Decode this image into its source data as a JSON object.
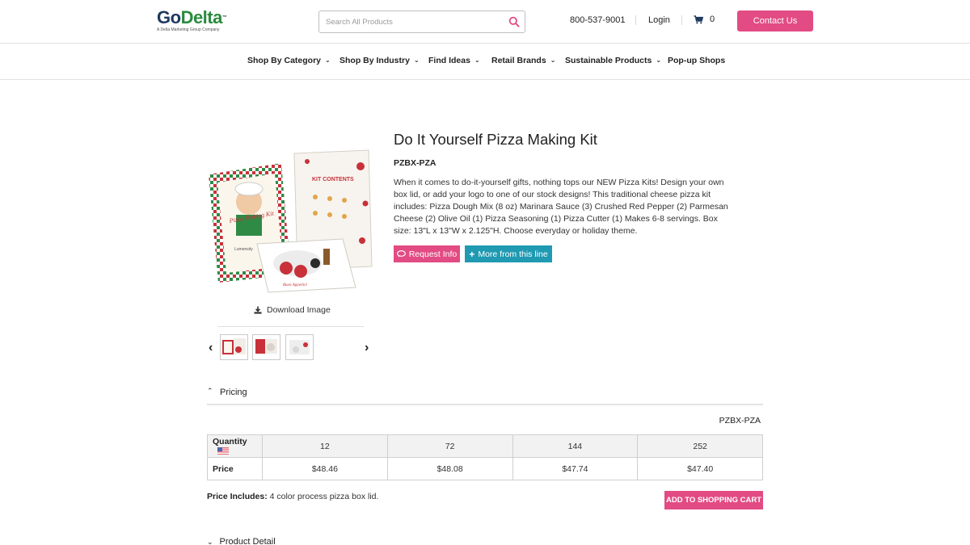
{
  "header": {
    "logo_text_go": "Go",
    "logo_text_delta": "Delta",
    "logo_tm": "™",
    "logo_tagline": "A Delta Marketing Group Company",
    "search_placeholder": "Search All Products",
    "phone": "800-537-9001",
    "login": "Login",
    "cart_count": "0",
    "contact_label": "Contact Us"
  },
  "nav": {
    "items": [
      {
        "label": "Shop By Category",
        "has_dropdown": true
      },
      {
        "label": "Shop By Industry",
        "has_dropdown": true
      },
      {
        "label": "Find Ideas",
        "has_dropdown": true
      },
      {
        "label": "Retail Brands",
        "has_dropdown": true
      },
      {
        "label": "Sustainable Products",
        "has_dropdown": true
      },
      {
        "label": "Pop-up Shops",
        "has_dropdown": false
      }
    ]
  },
  "product": {
    "title": "Do It Yourself Pizza Making Kit",
    "sku": "PZBX-PZA",
    "description": "When it comes to do-it-yourself gifts, nothing tops our NEW Pizza Kits! Design your own box lid, or add your logo to one of our stock designs! This traditional cheese pizza kit includes: Pizza Dough Mix (8 oz) Marinara Sauce (3) Crushed Red Pepper (2) Parmesan Cheese (2) Olive Oil (1) Pizza Seasoning (1) Pizza Cutter (1) Makes 6-8 servings. Box size: 13\"L x 13\"W x 2.125\"H. Choose everyday or holiday theme.",
    "request_info_label": "Request Info",
    "more_from_line_label": "More from this line",
    "download_image_label": "Download Image",
    "image_box_text": [
      "Pizza Making Kit",
      "KIT CONTENTS",
      "Buon Appetito!",
      "Lumensity"
    ]
  },
  "pricing": {
    "section_label": "Pricing",
    "sku": "PZBX-PZA",
    "quantity_label": "Quantity",
    "price_label": "Price",
    "quantities": [
      "12",
      "72",
      "144",
      "252"
    ],
    "prices": [
      "$48.46",
      "$48.08",
      "$47.74",
      "$47.40"
    ],
    "includes_label": "Price Includes:",
    "includes_value": "4 color process pizza box lid.",
    "add_to_cart_label": "ADD TO SHOPPING CART"
  },
  "detail": {
    "section_label": "Product Detail"
  },
  "colors": {
    "accent_pink": "#e24b83",
    "accent_teal": "#1f9ab2",
    "logo_navy": "#1e3a5f",
    "logo_green": "#2a8a3e"
  }
}
